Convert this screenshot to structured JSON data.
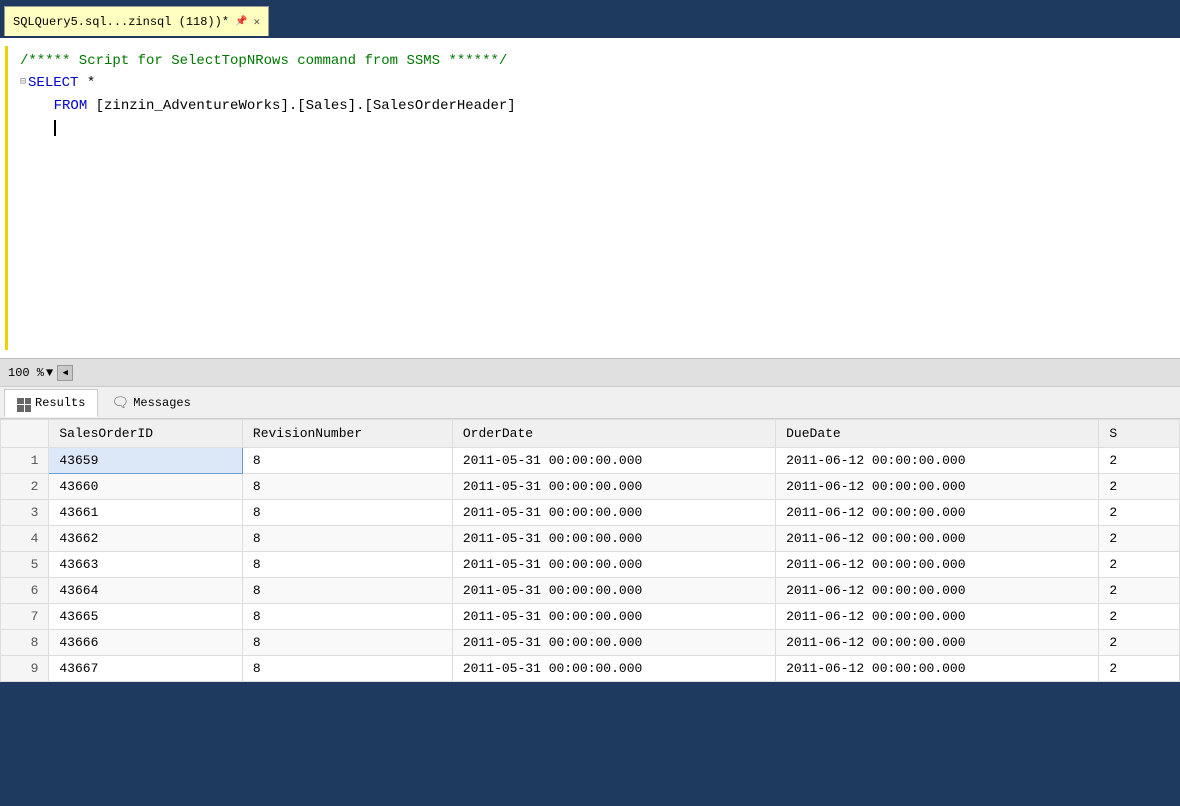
{
  "titlebar": {
    "tab_label": "SQLQuery5.sql...zinsql (118))*",
    "pin_icon": "📌",
    "close_icon": "✕"
  },
  "editor": {
    "comment": "/***** Script for SelectTopNRows command from SSMS  ******/",
    "line2_keyword": "SELECT",
    "line2_rest": " *",
    "line3_keyword": "FROM",
    "line3_rest": " [zinzin_AdventureWorks].[Sales].[SalesOrderHeader]",
    "line4": ""
  },
  "zoom": {
    "value": "100 %"
  },
  "results_tabs": [
    {
      "label": "Results",
      "icon_type": "grid"
    },
    {
      "label": "Messages",
      "icon_type": "msg"
    }
  ],
  "table": {
    "columns": [
      "",
      "SalesOrderID",
      "RevisionNumber",
      "OrderDate",
      "DueDate",
      "S"
    ],
    "rows": [
      {
        "row": "1",
        "salesorderid": "43659",
        "revision": "8",
        "orderdate": "2011-05-31 00:00:00.000",
        "duedate": "2011-06-12 00:00:00.000",
        "ship": "2",
        "selected": true
      },
      {
        "row": "2",
        "salesorderid": "43660",
        "revision": "8",
        "orderdate": "2011-05-31 00:00:00.000",
        "duedate": "2011-06-12 00:00:00.000",
        "ship": "2",
        "selected": false
      },
      {
        "row": "3",
        "salesorderid": "43661",
        "revision": "8",
        "orderdate": "2011-05-31 00:00:00.000",
        "duedate": "2011-06-12 00:00:00.000",
        "ship": "2",
        "selected": false
      },
      {
        "row": "4",
        "salesorderid": "43662",
        "revision": "8",
        "orderdate": "2011-05-31 00:00:00.000",
        "duedate": "2011-06-12 00:00:00.000",
        "ship": "2",
        "selected": false
      },
      {
        "row": "5",
        "salesorderid": "43663",
        "revision": "8",
        "orderdate": "2011-05-31 00:00:00.000",
        "duedate": "2011-06-12 00:00:00.000",
        "ship": "2",
        "selected": false
      },
      {
        "row": "6",
        "salesorderid": "43664",
        "revision": "8",
        "orderdate": "2011-05-31 00:00:00.000",
        "duedate": "2011-06-12 00:00:00.000",
        "ship": "2",
        "selected": false
      },
      {
        "row": "7",
        "salesorderid": "43665",
        "revision": "8",
        "orderdate": "2011-05-31 00:00:00.000",
        "duedate": "2011-06-12 00:00:00.000",
        "ship": "2",
        "selected": false
      },
      {
        "row": "8",
        "salesorderid": "43666",
        "revision": "8",
        "orderdate": "2011-05-31 00:00:00.000",
        "duedate": "2011-06-12 00:00:00.000",
        "ship": "2",
        "selected": false
      },
      {
        "row": "9",
        "salesorderid": "43667",
        "revision": "8",
        "orderdate": "2011-05-31 00:00:00.000",
        "duedate": "2011-06-12 00:00:00.000",
        "ship": "2",
        "selected": false
      }
    ]
  }
}
